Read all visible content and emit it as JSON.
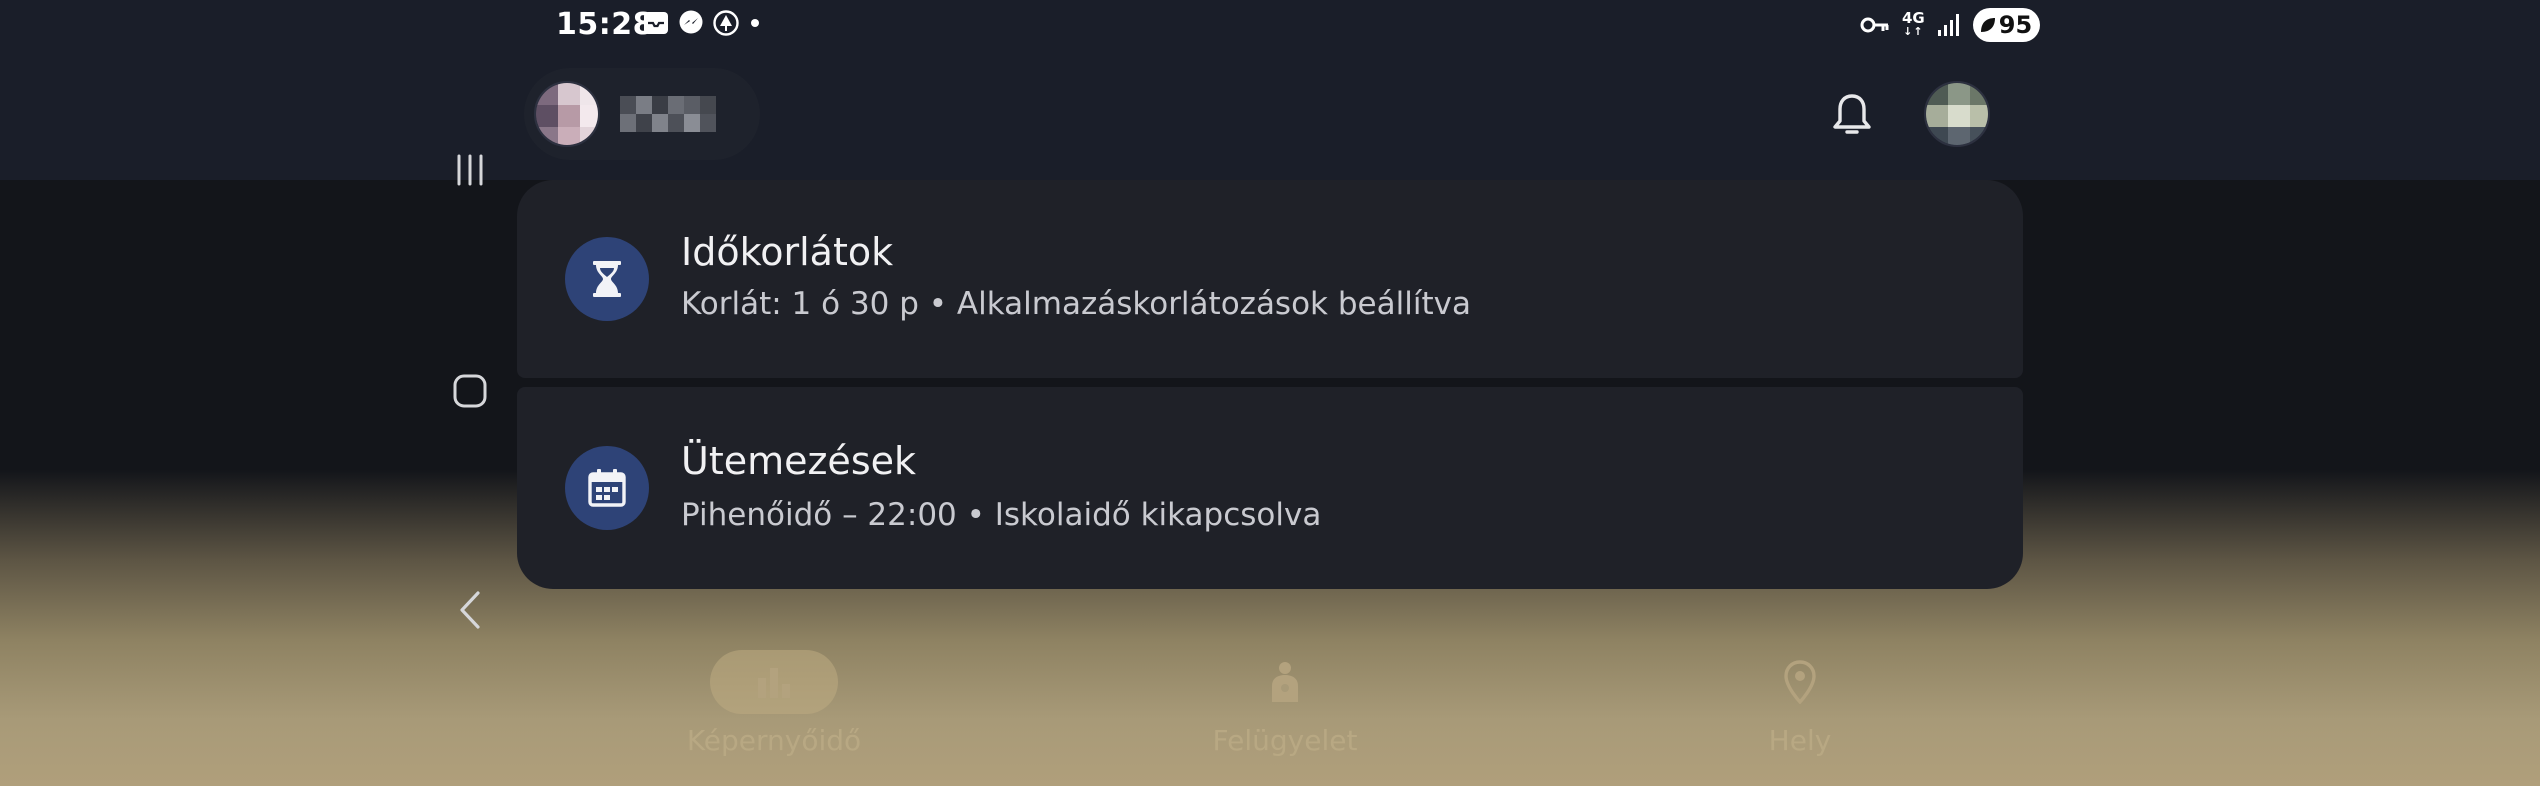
{
  "status_bar": {
    "time": "15:28",
    "network": "4G",
    "battery": "95",
    "notification_icons": [
      "inbox-icon",
      "messenger-icon",
      "tree-icon",
      "dot-icon"
    ],
    "system_icons": [
      "vpn-key-icon",
      "network-4g-icon",
      "signal-icon",
      "battery-saver-icon"
    ]
  },
  "header": {
    "account_avatar_icon": "avatar-icon",
    "bell_icon": "bell-icon",
    "profile_avatar_icon": "avatar-icon"
  },
  "cards": [
    {
      "icon": "hourglass-icon",
      "title": "Időkorlátok",
      "subtitle": "Korlát: 1 ó 30 p • Alkalmazáskorlátozások beállítva"
    },
    {
      "icon": "calendar-icon",
      "title": "Ütemezések",
      "subtitle": "Pihenőidő – 22:00 • Iskolaidő kikapcsolva"
    }
  ],
  "bottom_nav": [
    {
      "icon": "bar-chart-icon",
      "label": "Képernyőidő",
      "selected": true
    },
    {
      "icon": "child-supervision-icon",
      "label": "Felügyelet",
      "selected": false
    },
    {
      "icon": "location-pin-icon",
      "label": "Hely",
      "selected": false
    }
  ],
  "system_nav": [
    "recents-icon",
    "home-icon",
    "back-icon"
  ],
  "colors": {
    "card_background": "#1f2128",
    "icon_circle": "#2e4377",
    "header_background": "#1a1e29"
  }
}
